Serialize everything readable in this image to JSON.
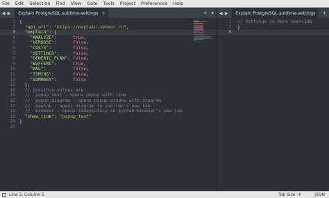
{
  "menu": [
    "File",
    "Edit",
    "Selection",
    "Find",
    "View",
    "Goto",
    "Tools",
    "Project",
    "Preferences",
    "Help"
  ],
  "left_tab": {
    "title": "Explain PostgreSQL.sublime-settings",
    "close": "×",
    "nav_back": "◀",
    "nav_forward": "▶",
    "add": "+",
    "more": "▾"
  },
  "right_tab": {
    "title": "Explain PostgreSQL.sublime-settings",
    "nav_back": "◀",
    "nav_forward": "▶",
    "add": "+",
    "more": "▾"
  },
  "left_lines": [
    "1",
    "2",
    "3",
    "4",
    "5",
    "6",
    "7",
    "8",
    "9",
    "10",
    "11",
    "12",
    "13",
    "14",
    "15",
    "16",
    "17",
    "18",
    "19",
    "20",
    "21"
  ],
  "left_current_line": 3,
  "left_code": {
    "l1": "{",
    "l2_key": "\"api_url\"",
    "l2_val": "\"https://explain.tensor.ru\"",
    "l3_key": "\"explain\"",
    "opts": [
      {
        "k": "\"ANALYZE\"",
        "v": "true"
      },
      {
        "k": "\"VERBOSE\"",
        "v": "false"
      },
      {
        "k": "\"COSTS\"",
        "v": "false"
      },
      {
        "k": "\"SETTINGS\"",
        "v": "false"
      },
      {
        "k": "\"GENERIC_PLAN\"",
        "v": "false"
      },
      {
        "k": "\"BUFFERS\"",
        "v": "true"
      },
      {
        "k": "\"WAL\"",
        "v": "false"
      },
      {
        "k": "\"TIMING\"",
        "v": "false"
      },
      {
        "k": "\"SUMMARY\"",
        "v": "false"
      }
    ],
    "l13": "},",
    "c1": "// possible values are:",
    "c2": "//  popup_text - opens popup with link",
    "c3": "//  popup_diagram - opens popup window with diagram",
    "c4": "//  newtab - opens diagram in sublime's new tab",
    "c5": "//  browser - opens immediately in system browser's new tab",
    "l19_key": "\"show_link\"",
    "l19_val": "\"popup_text\"",
    "l20": "}"
  },
  "right_lines": [
    "1",
    "2",
    "3"
  ],
  "right_current_line": 3,
  "right_code": {
    "c1": "// Settings in here override",
    "l2": "}"
  },
  "status": {
    "position": "Line 3, Column 5",
    "tab_size": "Tab Size: 4",
    "syntax": "JSON"
  },
  "colors": {
    "menubar": "#e8e8e8",
    "editor_bg": "#2b3137",
    "tab_bg": "#3a414a",
    "status_bg": "#e6e6e6"
  }
}
